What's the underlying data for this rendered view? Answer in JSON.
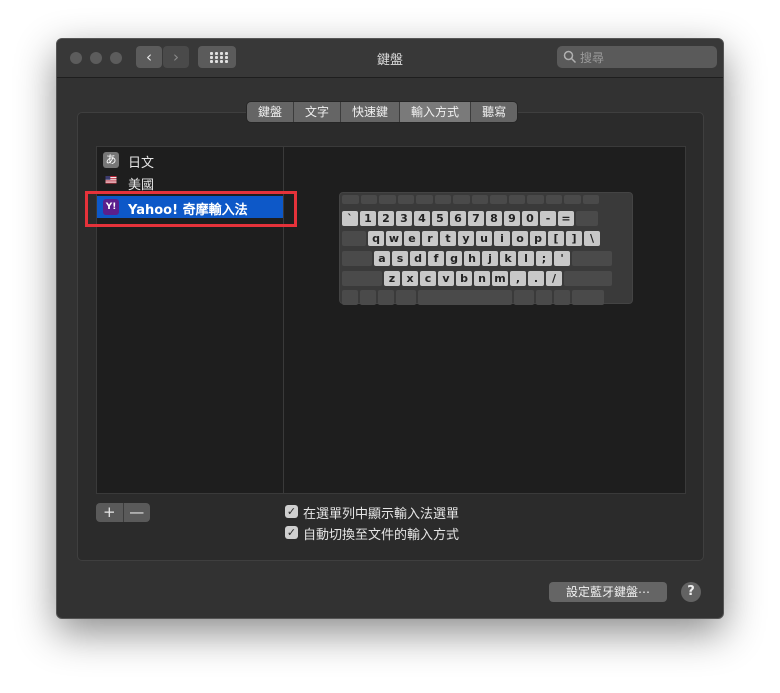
{
  "window": {
    "title": "鍵盤"
  },
  "toolbar": {
    "back_icon": "‹",
    "forward_icon": "›",
    "search_placeholder": "搜尋"
  },
  "tabs": [
    {
      "label": "鍵盤",
      "active": false
    },
    {
      "label": "文字",
      "active": false
    },
    {
      "label": "快速鍵",
      "active": false
    },
    {
      "label": "輸入方式",
      "active": true
    },
    {
      "label": "聽寫",
      "active": false
    }
  ],
  "input_sources": [
    {
      "label": "日文",
      "icon": "hiragana-a-icon",
      "icon_text": "あ",
      "selected": false
    },
    {
      "label": "美國",
      "icon": "us-flag-icon",
      "icon_text": "",
      "selected": false
    },
    {
      "label": "Yahoo! 奇摩輸入法",
      "icon": "yahoo-icon",
      "icon_text": "Y!",
      "selected": true
    }
  ],
  "keyboard_rows": [
    [
      "",
      "",
      "",
      "",
      "",
      "",
      "",
      "",
      "",
      "",
      "",
      "",
      "",
      ""
    ],
    [
      "`",
      "1",
      "2",
      "3",
      "4",
      "5",
      "6",
      "7",
      "8",
      "9",
      "0",
      "-",
      "=",
      ""
    ],
    [
      "",
      "q",
      "w",
      "e",
      "r",
      "t",
      "y",
      "u",
      "i",
      "o",
      "p",
      "[",
      "]",
      "\\"
    ],
    [
      "",
      "a",
      "s",
      "d",
      "f",
      "g",
      "h",
      "j",
      "k",
      "l",
      ";",
      "'",
      ""
    ],
    [
      "",
      "z",
      "x",
      "c",
      "v",
      "b",
      "n",
      "m",
      ",",
      ".",
      "/",
      ""
    ],
    [
      "",
      "",
      "",
      "",
      "",
      "",
      "",
      "",
      ""
    ]
  ],
  "list_controls": {
    "add": "+",
    "remove": "—"
  },
  "options": [
    {
      "label": "在選單列中顯示輸入法選單",
      "checked": true
    },
    {
      "label": "自動切換至文件的輸入方式",
      "checked": true
    }
  ],
  "footer": {
    "bluetooth_button": "設定藍牙鍵盤⋯",
    "help": "?"
  },
  "colors": {
    "selection": "#0d58c8",
    "highlight_box": "#e5323a"
  }
}
